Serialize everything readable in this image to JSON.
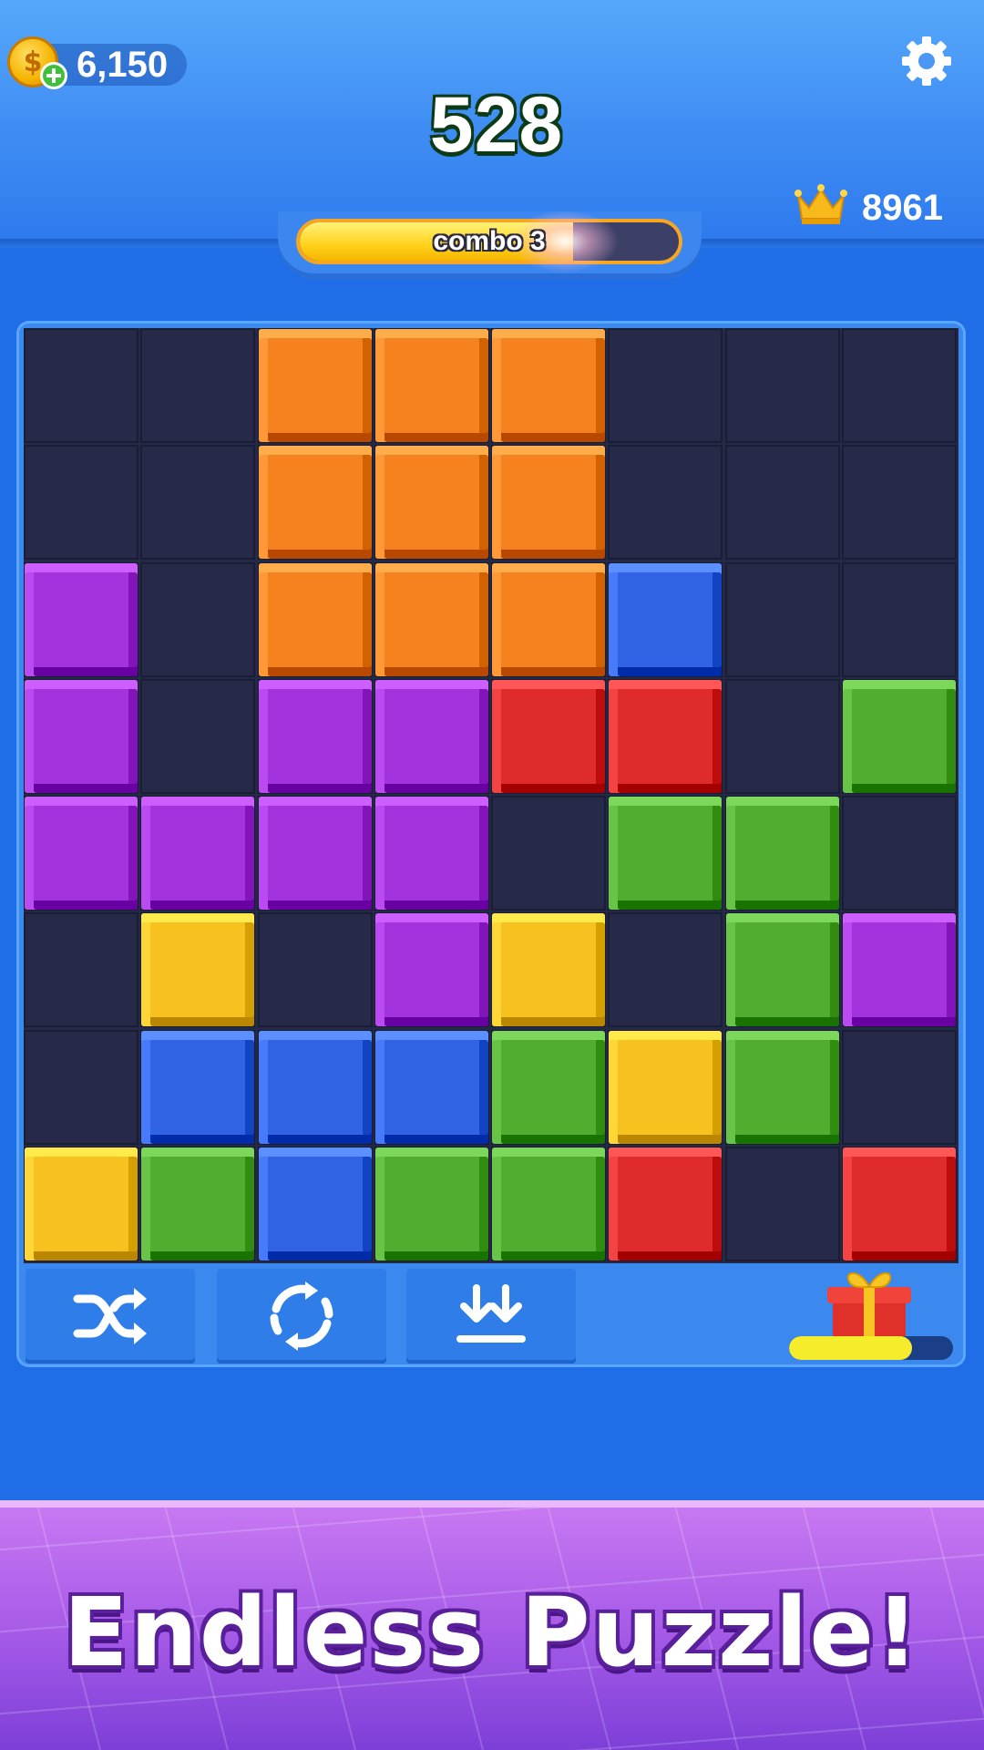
{
  "header": {
    "coins": "6,150",
    "score": "528",
    "best_score": "8961",
    "icons": {
      "coin": "coin-add-icon",
      "settings": "gear-icon",
      "best": "crown-icon"
    }
  },
  "combo": {
    "label": "combo 3",
    "progress": 0.72,
    "fill_color": "#ffd21a"
  },
  "board": {
    "rows": 8,
    "cols": 8,
    "colors": {
      "O": "#f07f1d",
      "P": "#a032d8",
      "B": "#2f62e0",
      "R": "#db2a2a",
      "G": "#4faa2e",
      "Y": "#f2bd1f",
      ".": null
    },
    "grid": [
      [
        ".",
        ".",
        "O",
        "O",
        "O",
        ".",
        ".",
        "."
      ],
      [
        ".",
        ".",
        "O",
        "O",
        "O",
        ".",
        ".",
        "."
      ],
      [
        "P",
        ".",
        "O",
        "O",
        "O",
        "B",
        ".",
        "."
      ],
      [
        "P",
        ".",
        "P",
        "P",
        "R",
        "R",
        ".",
        "G"
      ],
      [
        "P",
        "P",
        "P",
        "P",
        ".",
        "G",
        "G",
        "."
      ],
      [
        ".",
        "Y",
        ".",
        "P",
        "Y",
        ".",
        "G",
        "P"
      ],
      [
        ".",
        "B",
        "B",
        "B",
        "G",
        "Y",
        "G",
        "."
      ],
      [
        "Y",
        "G",
        "B",
        "G",
        "G",
        "R",
        ".",
        "R"
      ]
    ]
  },
  "toolbar": {
    "buttons": [
      {
        "name": "shuffle-button",
        "icon": "shuffle-icon"
      },
      {
        "name": "rotate-button",
        "icon": "rotate-icon"
      },
      {
        "name": "drop-button",
        "icon": "drop-down-icon"
      }
    ],
    "gift_progress": 0.75
  },
  "banner": {
    "text": "Endless Puzzle!"
  }
}
